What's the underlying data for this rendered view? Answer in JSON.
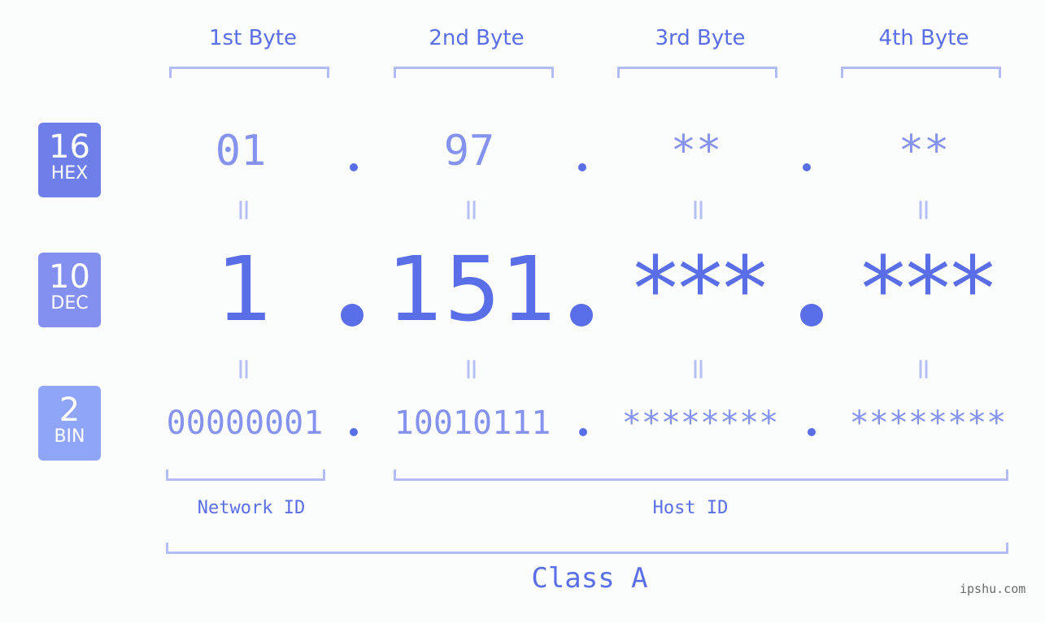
{
  "bytes": {
    "labels": [
      "1st Byte",
      "2nd Byte",
      "3rd Byte",
      "4th Byte"
    ]
  },
  "bases": {
    "hex": {
      "number": "16",
      "label": "HEX",
      "color": "#6f7fe9"
    },
    "dec": {
      "number": "10",
      "label": "DEC",
      "color": "#8390ef"
    },
    "bin": {
      "number": "2",
      "label": "BIN",
      "color": "#8fa5f7"
    }
  },
  "hex_values": [
    "01",
    "97",
    "**",
    "**"
  ],
  "dec_values": [
    "1",
    "151",
    "***",
    "***"
  ],
  "bin_values": [
    "00000001",
    "10010111",
    "********",
    "********"
  ],
  "equals_sign": "=",
  "segments": {
    "network_id": "Network ID",
    "host_id": "Host ID"
  },
  "ip_class": "Class A",
  "watermark": "ipshu.com",
  "colors": {
    "primary": "#5a6ee8",
    "secondary": "#8592ee",
    "bracket": "#b3bcf5",
    "background": "#fbfdfc"
  }
}
